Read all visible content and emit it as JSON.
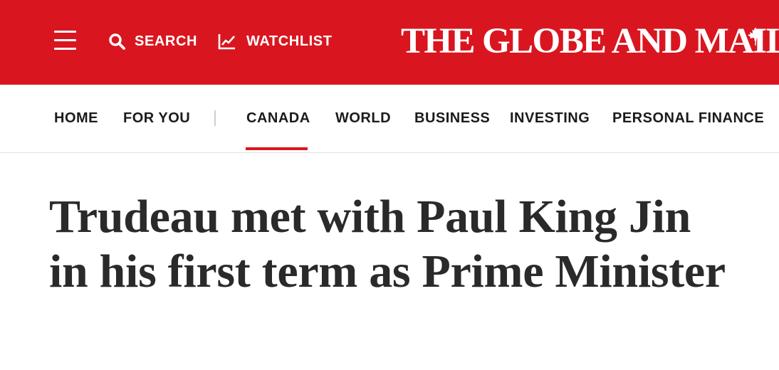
{
  "header": {
    "search_label": "SEARCH",
    "watchlist_label": "WATCHLIST",
    "logo_text": "THE GLOBE AND MAIL",
    "brand_color": "#d9161f",
    "icons": [
      "menu-icon",
      "search-icon",
      "chart-line-icon",
      "maple-leaf-icon"
    ]
  },
  "nav": {
    "items": [
      {
        "label": "HOME"
      },
      {
        "label": "FOR YOU"
      },
      {
        "label": "CANADA",
        "active": true
      },
      {
        "label": "WORLD"
      },
      {
        "label": "BUSINESS"
      },
      {
        "label": "INVESTING"
      },
      {
        "label": "PERSONAL FINANCE"
      }
    ]
  },
  "article": {
    "headline": "Trudeau met with Paul King Jin in his first term as Prime Minister"
  }
}
